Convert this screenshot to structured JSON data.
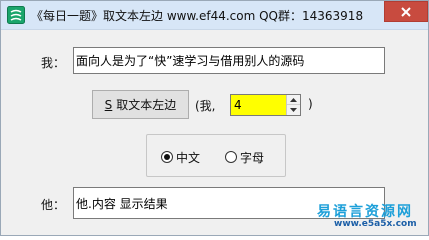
{
  "window": {
    "title": "《每日一题》取文本左边 www.ef44.com QQ群：14363918"
  },
  "form": {
    "me_label": "我：",
    "me_text": "面向人是为了“快”速学习与借用别人的源码",
    "button": {
      "mnemonic": "S",
      "label": "取文本左边"
    },
    "param_open": "(我,",
    "spin_value": "4",
    "param_close": ")",
    "radio": {
      "chinese_label": "中文",
      "letter_label": "字母",
      "selected": "中文"
    },
    "he_label": "他：",
    "he_text": "他.内容   显示结果"
  },
  "watermark": {
    "cn": "易语言资源网",
    "url": "www.e5a5x.com"
  }
}
